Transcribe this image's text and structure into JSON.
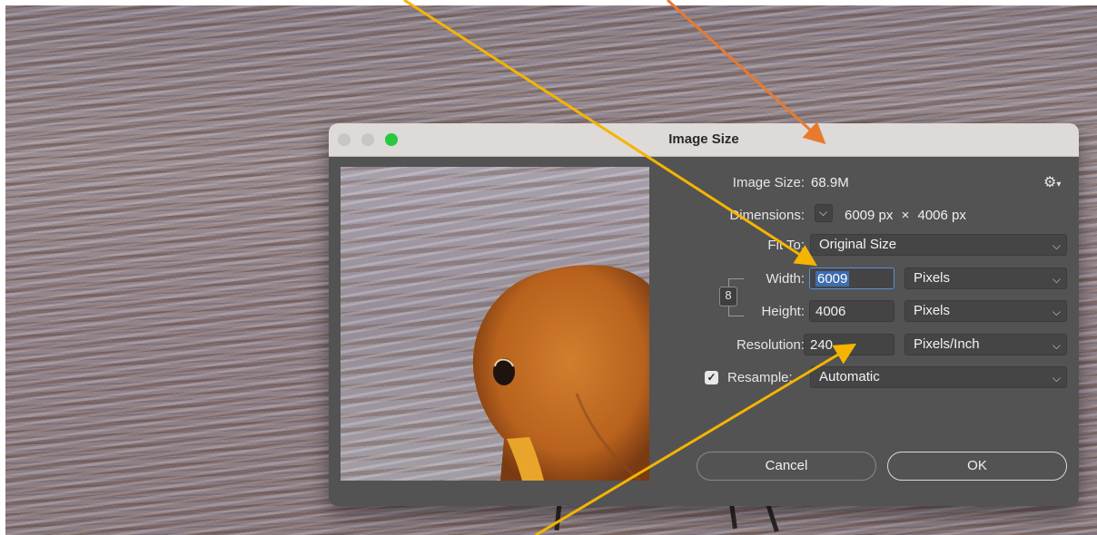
{
  "window": {
    "title": "Image Size"
  },
  "info": {
    "image_size_label": "Image Size:",
    "image_size_value": "68.9M",
    "dimensions_label": "Dimensions:",
    "dimensions_width": "6009 px",
    "dimensions_times": "×",
    "dimensions_height": "4006 px"
  },
  "fit_to": {
    "label": "Fit To:",
    "value": "Original Size"
  },
  "width": {
    "label": "Width:",
    "value": "6009",
    "unit": "Pixels"
  },
  "height": {
    "label": "Height:",
    "value": "4006",
    "unit": "Pixels"
  },
  "resolution": {
    "label": "Resolution:",
    "value": "240",
    "unit": "Pixels/Inch"
  },
  "resample": {
    "label": "Resample:",
    "checked": true,
    "value": "Automatic"
  },
  "buttons": {
    "cancel": "Cancel",
    "ok": "OK"
  },
  "colors": {
    "arrow_yellow": "#f5b400",
    "arrow_orange": "#e87a2e",
    "dialog_bg": "#535353",
    "traffic_close": "#c8c5c4",
    "traffic_min": "#c8c5c4",
    "traffic_max": "#28c840"
  },
  "icons": [
    "gear-icon",
    "chain-link-icon",
    "chevron-down-icon",
    "checkbox-icon"
  ]
}
